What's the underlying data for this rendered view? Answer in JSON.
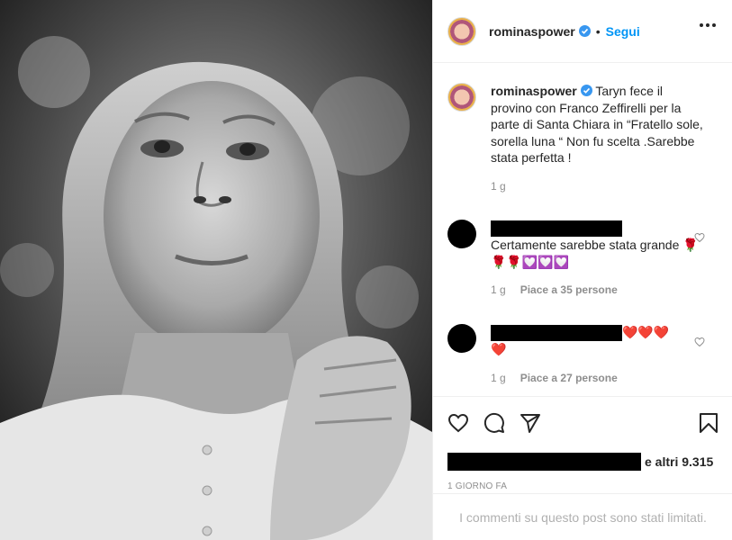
{
  "post": {
    "username": "rominaspower",
    "follow_label": "Segui",
    "dot": "•",
    "caption": "Taryn fece il provino con Franco Zeffirelli per la parte di Santa Chiara in “Fratello sole, sorella luna “ Non fu scelta .Sarebbe stata perfetta !",
    "caption_time": "1 g"
  },
  "comments": [
    {
      "text": "Certamente sarebbe stata grande",
      "emojis": "🌹🌹🌹💟💟💟",
      "time": "1 g",
      "likes": "Piace a 35 persone"
    },
    {
      "text": "❤️❤️❤️",
      "text2": "❤️",
      "time": "1 g",
      "likes": "Piace a 27 persone"
    }
  ],
  "likes_suffix": "e altri 9.315",
  "time_ago": "1 GIORNO FA",
  "footer_text": "I commenti su questo post sono stati limitati.",
  "icons": {
    "like": "heart-icon",
    "comment": "comment-icon",
    "share": "paper-plane-icon",
    "save": "bookmark-icon",
    "verified": "verified-badge-icon",
    "more": "more-options-icon"
  },
  "colors": {
    "accent": "#0095f6",
    "verified": "#3897f0",
    "muted": "#8e8e8e"
  }
}
